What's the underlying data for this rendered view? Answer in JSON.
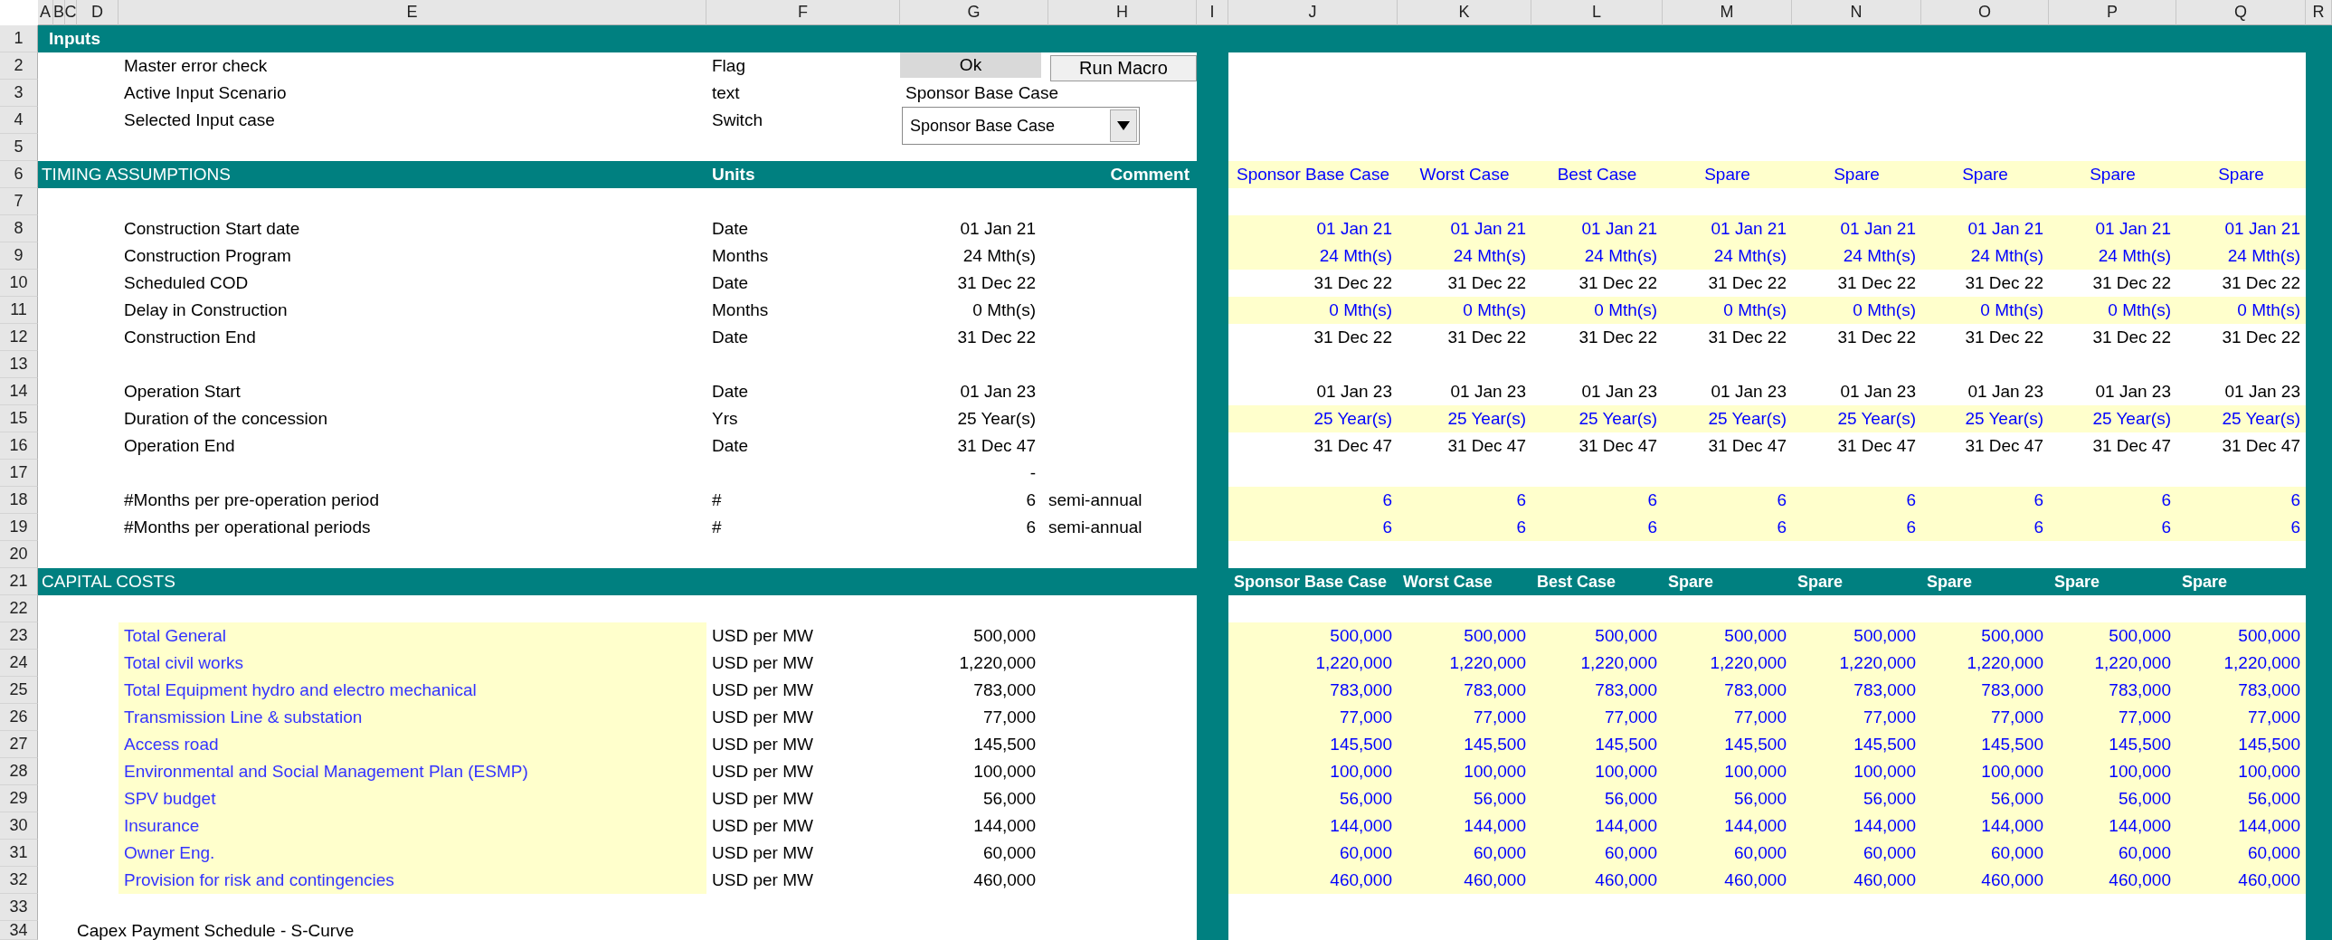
{
  "column_headers": [
    "A",
    "B",
    "C",
    "D",
    "E",
    "F",
    "G",
    "H",
    "I",
    "J",
    "K",
    "L",
    "M",
    "N",
    "O",
    "P",
    "Q",
    "R"
  ],
  "row_numbers": [
    "1",
    "2",
    "3",
    "4",
    "5",
    "6",
    "7",
    "8",
    "9",
    "10",
    "11",
    "12",
    "13",
    "14",
    "15",
    "16",
    "17",
    "18",
    "19",
    "20",
    "21",
    "22",
    "23",
    "24",
    "25",
    "26",
    "27",
    "28",
    "29",
    "30",
    "31",
    "32",
    "33",
    "34"
  ],
  "title": "Inputs",
  "controls": [
    {
      "kind": "status",
      "label": "Master error check",
      "unit": "Flag",
      "value": "Ok",
      "button": "Run Macro"
    },
    {
      "kind": "text",
      "label": "Active Input Scenario",
      "unit": "text",
      "value": "Sponsor Base Case"
    },
    {
      "kind": "dropdown",
      "label": "Selected Input case",
      "unit": "Switch",
      "value": "Sponsor Base Case"
    }
  ],
  "timing": {
    "title": "TIMING ASSUMPTIONS",
    "units_header": "Units",
    "comment_header": "Comment",
    "kind": "input",
    "cases": [
      "Sponsor Base Case",
      "Worst Case",
      "Best Case",
      "Spare",
      "Spare",
      "Spare",
      "Spare",
      "Spare"
    ],
    "rows": [
      {
        "kind": "blank"
      },
      {
        "kind": "data",
        "label": "Construction Start date",
        "unit": "Date",
        "value": "01 Jan 21",
        "input": true,
        "cases": [
          "01 Jan 21",
          "01 Jan 21",
          "01 Jan 21",
          "01 Jan 21",
          "01 Jan 21",
          "01 Jan 21",
          "01 Jan 21",
          "01 Jan 21"
        ]
      },
      {
        "kind": "data",
        "label": "Construction Program",
        "unit": "Months",
        "value": "24 Mth(s)",
        "input": true,
        "cases": [
          "24 Mth(s)",
          "24 Mth(s)",
          "24 Mth(s)",
          "24 Mth(s)",
          "24 Mth(s)",
          "24 Mth(s)",
          "24 Mth(s)",
          "24 Mth(s)"
        ]
      },
      {
        "kind": "data",
        "label": "Scheduled COD",
        "unit": "Date",
        "value": "31 Dec 22",
        "input": false,
        "cases": [
          "31 Dec 22",
          "31 Dec 22",
          "31 Dec 22",
          "31 Dec 22",
          "31 Dec 22",
          "31 Dec 22",
          "31 Dec 22",
          "31 Dec 22"
        ]
      },
      {
        "kind": "data",
        "label": "Delay in Construction",
        "unit": "Months",
        "value": "0 Mth(s)",
        "input": true,
        "cases": [
          "0 Mth(s)",
          "0 Mth(s)",
          "0 Mth(s)",
          "0 Mth(s)",
          "0 Mth(s)",
          "0 Mth(s)",
          "0 Mth(s)",
          "0 Mth(s)"
        ]
      },
      {
        "kind": "data",
        "label": "Construction End",
        "unit": "Date",
        "value": "31 Dec 22",
        "input": false,
        "cases": [
          "31 Dec 22",
          "31 Dec 22",
          "31 Dec 22",
          "31 Dec 22",
          "31 Dec 22",
          "31 Dec 22",
          "31 Dec 22",
          "31 Dec 22"
        ]
      },
      {
        "kind": "blank"
      },
      {
        "kind": "data",
        "label": "Operation Start",
        "unit": "Date",
        "value": "01 Jan 23",
        "input": false,
        "cases": [
          "01 Jan 23",
          "01 Jan 23",
          "01 Jan 23",
          "01 Jan 23",
          "01 Jan 23",
          "01 Jan 23",
          "01 Jan 23",
          "01 Jan 23"
        ]
      },
      {
        "kind": "data",
        "label": "Duration of the concession",
        "unit": "Yrs",
        "value": "25 Year(s)",
        "input": true,
        "cases": [
          "25 Year(s)",
          "25 Year(s)",
          "25 Year(s)",
          "25 Year(s)",
          "25 Year(s)",
          "25 Year(s)",
          "25 Year(s)",
          "25 Year(s)"
        ]
      },
      {
        "kind": "data",
        "label": "Operation End",
        "unit": "Date",
        "value": "31 Dec 47",
        "input": false,
        "cases": [
          "31 Dec 47",
          "31 Dec 47",
          "31 Dec 47",
          "31 Dec 47",
          "31 Dec 47",
          "31 Dec 47",
          "31 Dec 47",
          "31 Dec 47"
        ]
      },
      {
        "kind": "data",
        "value": "-"
      },
      {
        "kind": "data",
        "label": "#Months per pre-operation period",
        "unit": "#",
        "value": "6",
        "comment": "semi-annual",
        "input": true,
        "cases": [
          "6",
          "6",
          "6",
          "6",
          "6",
          "6",
          "6",
          "6"
        ]
      },
      {
        "kind": "data",
        "label": "#Months per operational periods",
        "unit": "#",
        "value": "6",
        "comment": "semi-annual",
        "input": true,
        "cases": [
          "6",
          "6",
          "6",
          "6",
          "6",
          "6",
          "6",
          "6"
        ]
      },
      {
        "kind": "blank"
      }
    ]
  },
  "capital_costs": {
    "title": "CAPITAL COSTS",
    "kind": "band",
    "cases": [
      "Sponsor Base Case",
      "Worst Case",
      "Best Case",
      "Spare",
      "Spare",
      "Spare",
      "Spare",
      "Spare"
    ],
    "rows": [
      {
        "kind": "blank"
      },
      {
        "kind": "data",
        "label": "Total General",
        "highlight_label": true,
        "unit": "USD per MW",
        "value": "500,000",
        "input": true,
        "cases": [
          "500,000",
          "500,000",
          "500,000",
          "500,000",
          "500,000",
          "500,000",
          "500,000",
          "500,000"
        ]
      },
      {
        "kind": "data",
        "label": "Total civil works",
        "highlight_label": true,
        "unit": "USD per MW",
        "value": "1,220,000",
        "input": true,
        "cases": [
          "1,220,000",
          "1,220,000",
          "1,220,000",
          "1,220,000",
          "1,220,000",
          "1,220,000",
          "1,220,000",
          "1,220,000"
        ]
      },
      {
        "kind": "data",
        "label": "Total Equipment hydro and electro mechanical",
        "highlight_label": true,
        "unit": "USD per MW",
        "value": "783,000",
        "input": true,
        "cases": [
          "783,000",
          "783,000",
          "783,000",
          "783,000",
          "783,000",
          "783,000",
          "783,000",
          "783,000"
        ]
      },
      {
        "kind": "data",
        "label": "Transmission Line & substation",
        "highlight_label": true,
        "unit": "USD per MW",
        "value": "77,000",
        "input": true,
        "cases": [
          "77,000",
          "77,000",
          "77,000",
          "77,000",
          "77,000",
          "77,000",
          "77,000",
          "77,000"
        ]
      },
      {
        "kind": "data",
        "label": "Access road",
        "highlight_label": true,
        "unit": "USD per MW",
        "value": "145,500",
        "input": true,
        "cases": [
          "145,500",
          "145,500",
          "145,500",
          "145,500",
          "145,500",
          "145,500",
          "145,500",
          "145,500"
        ]
      },
      {
        "kind": "data",
        "label": "Environmental and Social Management Plan (ESMP)",
        "highlight_label": true,
        "unit": "USD per MW",
        "value": "100,000",
        "input": true,
        "cases": [
          "100,000",
          "100,000",
          "100,000",
          "100,000",
          "100,000",
          "100,000",
          "100,000",
          "100,000"
        ]
      },
      {
        "kind": "data",
        "label": "SPV budget",
        "highlight_label": true,
        "unit": "USD per MW",
        "value": "56,000",
        "input": true,
        "cases": [
          "56,000",
          "56,000",
          "56,000",
          "56,000",
          "56,000",
          "56,000",
          "56,000",
          "56,000"
        ]
      },
      {
        "kind": "data",
        "label": "Insurance",
        "highlight_label": true,
        "unit": "USD per MW",
        "value": "144,000",
        "input": true,
        "cases": [
          "144,000",
          "144,000",
          "144,000",
          "144,000",
          "144,000",
          "144,000",
          "144,000",
          "144,000"
        ]
      },
      {
        "kind": "data",
        "label": "Owner Eng.",
        "highlight_label": true,
        "unit": "USD per MW",
        "value": "60,000",
        "input": true,
        "cases": [
          "60,000",
          "60,000",
          "60,000",
          "60,000",
          "60,000",
          "60,000",
          "60,000",
          "60,000"
        ]
      },
      {
        "kind": "data",
        "label": "Provision for risk and contingencies",
        "highlight_label": true,
        "unit": "USD per MW",
        "value": "460,000",
        "input": true,
        "cases": [
          "460,000",
          "460,000",
          "460,000",
          "460,000",
          "460,000",
          "460,000",
          "460,000",
          "460,000"
        ]
      },
      {
        "kind": "blank"
      },
      {
        "kind": "note",
        "text": "Capex Payment Schedule - S-Curve"
      }
    ]
  }
}
